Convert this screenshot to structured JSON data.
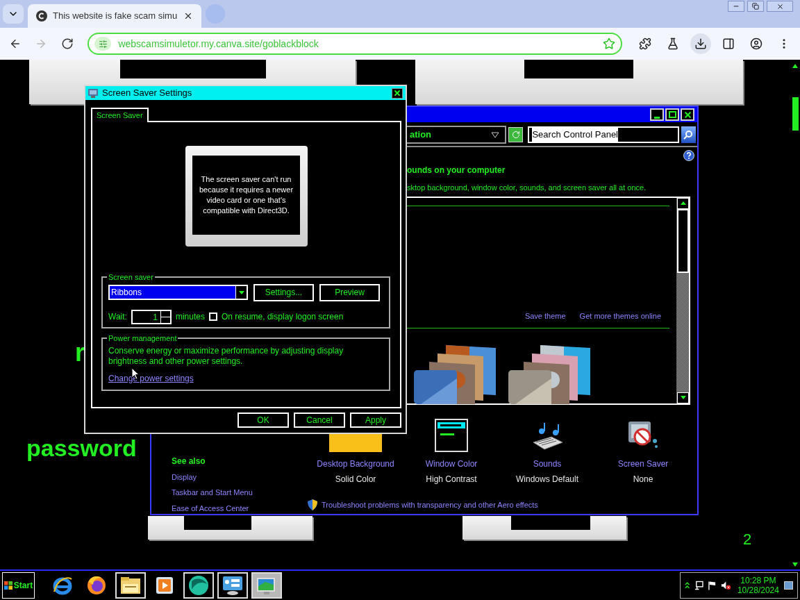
{
  "browser": {
    "tab": {
      "title": "This website is fake scam simu",
      "selected": true
    },
    "nav": [
      {
        "kind": "back",
        "disabled": false
      },
      {
        "kind": "forward",
        "disabled": true
      },
      {
        "kind": "reload",
        "disabled": false
      }
    ],
    "url": "webscamsimuletor.my.canva.site/goblackblock",
    "tools": [
      {
        "kind": "extensions",
        "active": false
      },
      {
        "kind": "labs",
        "active": false
      },
      {
        "kind": "download",
        "active": true
      },
      {
        "kind": "sidebar",
        "active": false
      },
      {
        "kind": "profile",
        "active": false
      },
      {
        "kind": "menu",
        "active": false
      }
    ]
  },
  "page": {
    "texts": [
      "r",
      "password",
      "2"
    ]
  },
  "control_panel": {
    "address": "ation",
    "search": {
      "value": "Search Control Panel",
      "highlighted": true
    },
    "heading": "ounds on your computer",
    "subtitle": "sktop background, window color, sounds, and screen saver all at once.",
    "theme_links": [
      "Save theme",
      "Get more themes online"
    ],
    "see_also": {
      "title": "See also",
      "links": [
        "Display",
        "Taskbar and Start Menu",
        "Ease of Access Center"
      ]
    },
    "items": [
      {
        "kind": "background",
        "title": "Desktop Background",
        "value": "Solid Color"
      },
      {
        "kind": "window_color",
        "title": "Window Color",
        "value": "High Contrast"
      },
      {
        "kind": "sounds",
        "title": "Sounds",
        "value": "Windows Default"
      },
      {
        "kind": "screensaver",
        "title": "Screen Saver",
        "value": "None"
      }
    ],
    "troubleshoot": "Troubleshoot problems with transparency and other Aero effects"
  },
  "dialog": {
    "title": "Screen Saver Settings",
    "tabs": [
      {
        "label": "Screen Saver",
        "selected": true
      }
    ],
    "preview_message": "The screen saver can't run because it requires a newer video card or one that's compatible with Direct3D.",
    "screen_saver": {
      "title": "Screen saver",
      "selected_saver": "Ribbons",
      "buttons": [
        "Settings...",
        "Preview"
      ],
      "wait_label": "Wait:",
      "wait_value": "1",
      "wait_unit": "minutes",
      "logon": {
        "label": "On resume, display logon screen",
        "checked": false
      }
    },
    "power": {
      "title": "Power management",
      "text": "Conserve energy or maximize performance by adjusting display brightness and other power settings.",
      "link": "Change power settings"
    },
    "buttons": [
      "OK",
      "Cancel",
      "Apply"
    ]
  },
  "taskbar": {
    "start": "Start",
    "apps": [
      {
        "kind": "ie",
        "running": false,
        "selected": false
      },
      {
        "kind": "firefox",
        "running": false,
        "selected": false
      },
      {
        "kind": "explorer",
        "running": true,
        "selected": false
      },
      {
        "kind": "media",
        "running": false,
        "selected": false
      },
      {
        "kind": "globe",
        "running": true,
        "selected": false
      },
      {
        "kind": "control_panel",
        "running": true,
        "selected": false
      },
      {
        "kind": "screensaver",
        "running": true,
        "selected": true
      }
    ],
    "volume_muted": true,
    "time": "10:28 PM",
    "date": "10/28/2024"
  }
}
